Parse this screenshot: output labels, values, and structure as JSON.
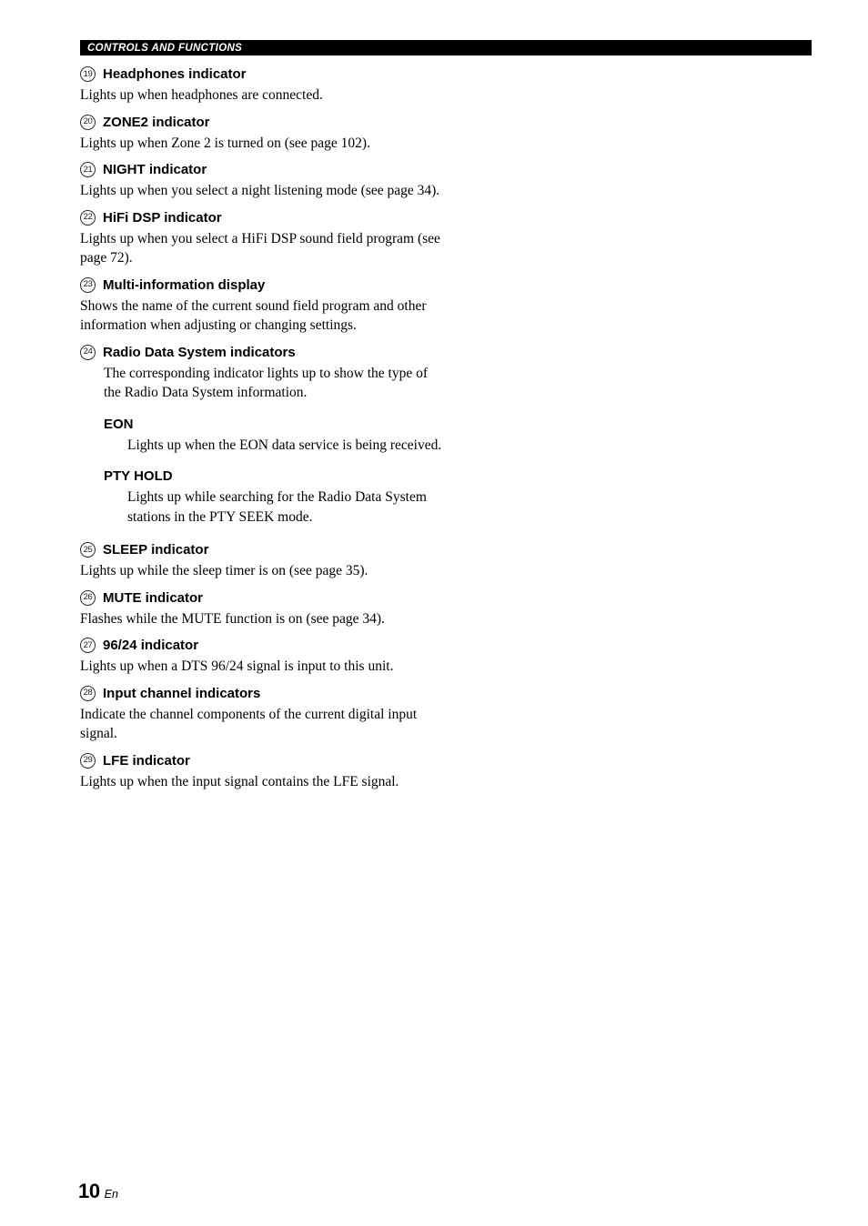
{
  "header": {
    "title": "CONTROLS AND FUNCTIONS"
  },
  "entries": [
    {
      "number": "19",
      "title": "Headphones indicator",
      "body": "Lights up when headphones are connected.",
      "indented": false
    },
    {
      "number": "20",
      "title": "ZONE2 indicator",
      "body": "Lights up when Zone 2 is turned on (see page 102).",
      "indented": false
    },
    {
      "number": "21",
      "title": "NIGHT indicator",
      "body": "Lights up when you select a night listening mode (see page 34).",
      "indented": false
    },
    {
      "number": "22",
      "title": "HiFi DSP indicator",
      "body": "Lights up when you select a HiFi DSP sound field program (see page 72).",
      "indented": false
    },
    {
      "number": "23",
      "title": "Multi-information display",
      "body": "Shows the name of the current sound field program and other information when adjusting or changing settings.",
      "indented": false
    },
    {
      "number": "24",
      "title": "Radio Data System indicators",
      "body": "The corresponding indicator lights up to show the type of the Radio Data System information.",
      "indented": true,
      "sub_entries": [
        {
          "title": "EON",
          "body": "Lights up when the EON data service is being received."
        },
        {
          "title": "PTY HOLD",
          "body": "Lights up while searching for the Radio Data System stations in the PTY SEEK mode."
        }
      ]
    },
    {
      "number": "25",
      "title": "SLEEP indicator",
      "body": "Lights up while the sleep timer is on (see page 35).",
      "indented": false
    },
    {
      "number": "26",
      "title": "MUTE indicator",
      "body": "Flashes while the MUTE function is on (see page 34).",
      "indented": false
    },
    {
      "number": "27",
      "title": "96/24 indicator",
      "body": "Lights up when a DTS 96/24 signal is input to this unit.",
      "indented": false
    },
    {
      "number": "28",
      "title": "Input channel indicators",
      "body": "Indicate the channel components of the current digital input signal.",
      "indented": false
    },
    {
      "number": "29",
      "title": "LFE indicator",
      "body": "Lights up when the input signal contains the LFE signal.",
      "indented": false
    }
  ],
  "footer": {
    "page_number": "10",
    "language": "En"
  }
}
